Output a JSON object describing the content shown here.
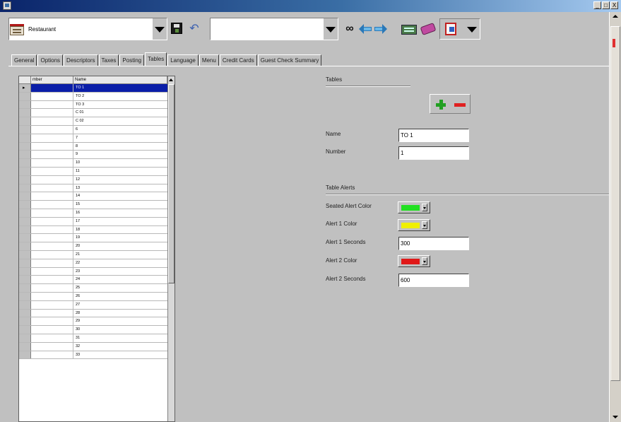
{
  "window": {
    "controls": [
      "_",
      "□",
      "X"
    ],
    "icon": "app-icon"
  },
  "toolbar": {
    "location": {
      "value": "Restaurant",
      "icon": "restaurant-location-icon"
    },
    "search": {
      "value": ""
    },
    "icons": [
      "save-icon",
      "undo-icon",
      "binoculars-icon",
      "back-arrow-icon",
      "forward-arrow-icon",
      "database-icon",
      "eraser-icon",
      "report-icon"
    ]
  },
  "tabs": [
    {
      "label": "General"
    },
    {
      "label": "Options"
    },
    {
      "label": "Descriptors"
    },
    {
      "label": "Taxes"
    },
    {
      "label": "Posting"
    },
    {
      "label": "Tables",
      "active": true
    },
    {
      "label": "Language"
    },
    {
      "label": "Menu"
    },
    {
      "label": "Credit Cards"
    },
    {
      "label": "Guest Check Summary"
    }
  ],
  "grid": {
    "columns": [
      "",
      "mber",
      "Name"
    ],
    "selected_indicator": "▸",
    "rows": [
      "TO 1",
      "TO 2",
      "TO 3",
      "C 01",
      "C 02",
      "6",
      "7",
      "8",
      "9",
      "10",
      "11",
      "12",
      "13",
      "14",
      "15",
      "16",
      "17",
      "18",
      "19",
      "20",
      "21",
      "22",
      "23",
      "24",
      "25",
      "26",
      "27",
      "28",
      "29",
      "30",
      "31",
      "32",
      "33"
    ]
  },
  "tables_section": {
    "title": "Tables",
    "name_label": "Name",
    "name_value": "TO 1",
    "number_label": "Number",
    "number_value": "1"
  },
  "alerts_section": {
    "title": "Table Alerts",
    "seated_label": "Seated Alert Color",
    "seated_color": "#22e022",
    "alert1_color_label": "Alert 1 Color",
    "alert1_color": "#f0f000",
    "alert1_seconds_label": "Alert 1 Seconds",
    "alert1_seconds": "300",
    "alert2_color_label": "Alert 2 Color",
    "alert2_color": "#e01818",
    "alert2_seconds_label": "Alert 2 Seconds",
    "alert2_seconds": "600"
  }
}
